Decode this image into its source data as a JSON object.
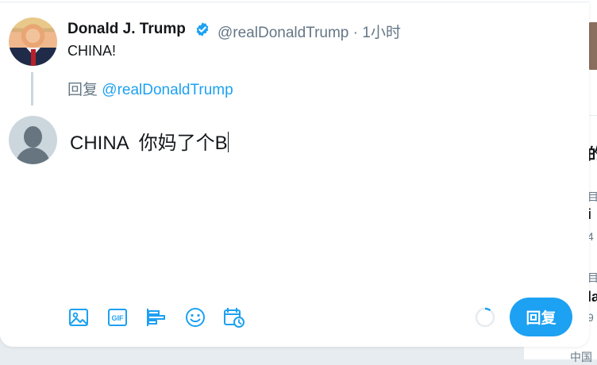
{
  "tweet": {
    "author_name": "Donald J. Trump",
    "handle_time": "@realDonaldTrump · 1小时",
    "text": "CHINA!"
  },
  "reply": {
    "prefix": "回复",
    "mention": "@realDonaldTrump"
  },
  "composer": {
    "text": "CHINA  你妈了个B"
  },
  "toolbar": {
    "icons": [
      "image-icon",
      "gif-icon",
      "poll-icon",
      "emoji-icon",
      "schedule-icon"
    ]
  },
  "reply_button": {
    "label": "回复"
  },
  "background": {
    "heading_fragment": "的",
    "row1_sub": "目",
    "row1_bold": "i",
    "row1_count": "4",
    "row2_sub": "目",
    "row2_bold": "la",
    "row2_count": "9",
    "footer_fragment": "中国"
  },
  "colors": {
    "accent": "#1da1f2",
    "text_primary": "#14171a",
    "text_secondary": "#657786",
    "divider": "#ccd6dd"
  }
}
